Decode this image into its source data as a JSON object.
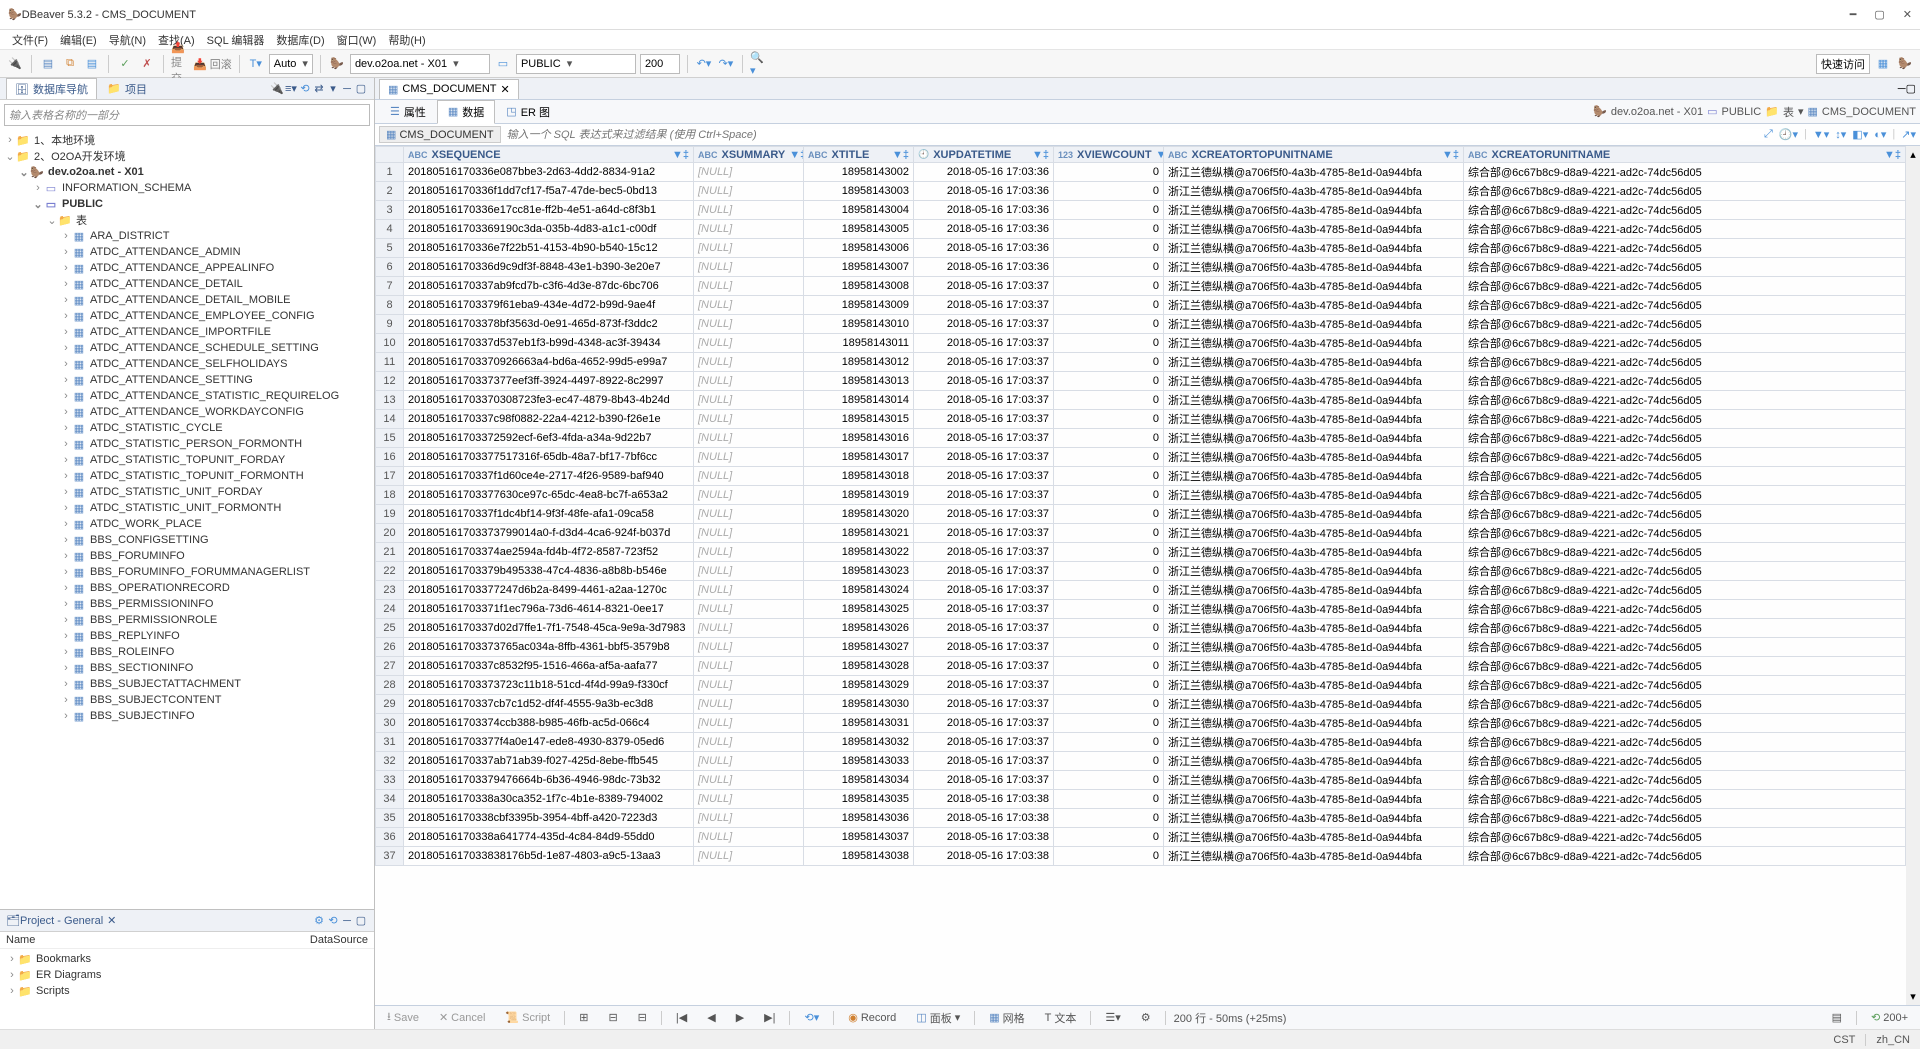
{
  "window_title": "DBeaver 5.3.2 - CMS_DOCUMENT",
  "menus": [
    "文件(F)",
    "编辑(E)",
    "导航(N)",
    "查找(A)",
    "SQL 编辑器",
    "数据库(D)",
    "窗口(W)",
    "帮助(H)"
  ],
  "toolbar": {
    "auto": "Auto",
    "connection": "dev.o2oa.net - X01",
    "schema": "PUBLIC",
    "limit": "200",
    "quick_access": "快速访问"
  },
  "nav": {
    "tab1": "数据库导航",
    "tab2": "项目",
    "filter_placeholder": "输入表格名称的一部分",
    "root1": "1、本地环境",
    "root2": "2、O2OA开发环境",
    "conn": "dev.o2oa.net - X01",
    "schema_info": "INFORMATION_SCHEMA",
    "schema_public": "PUBLIC",
    "tables_label": "表",
    "tables": [
      "ARA_DISTRICT",
      "ATDC_ATTENDANCE_ADMIN",
      "ATDC_ATTENDANCE_APPEALINFO",
      "ATDC_ATTENDANCE_DETAIL",
      "ATDC_ATTENDANCE_DETAIL_MOBILE",
      "ATDC_ATTENDANCE_EMPLOYEE_CONFIG",
      "ATDC_ATTENDANCE_IMPORTFILE",
      "ATDC_ATTENDANCE_SCHEDULE_SETTING",
      "ATDC_ATTENDANCE_SELFHOLIDAYS",
      "ATDC_ATTENDANCE_SETTING",
      "ATDC_ATTENDANCE_STATISTIC_REQUIRELOG",
      "ATDC_ATTENDANCE_WORKDAYCONFIG",
      "ATDC_STATISTIC_CYCLE",
      "ATDC_STATISTIC_PERSON_FORMONTH",
      "ATDC_STATISTIC_TOPUNIT_FORDAY",
      "ATDC_STATISTIC_TOPUNIT_FORMONTH",
      "ATDC_STATISTIC_UNIT_FORDAY",
      "ATDC_STATISTIC_UNIT_FORMONTH",
      "ATDC_WORK_PLACE",
      "BBS_CONFIGSETTING",
      "BBS_FORUMINFO",
      "BBS_FORUMINFO_FORUMMANAGERLIST",
      "BBS_OPERATIONRECORD",
      "BBS_PERMISSIONINFO",
      "BBS_PERMISSIONROLE",
      "BBS_REPLYINFO",
      "BBS_ROLEINFO",
      "BBS_SECTIONINFO",
      "BBS_SUBJECTATTACHMENT",
      "BBS_SUBJECTCONTENT",
      "BBS_SUBJECTINFO"
    ]
  },
  "project": {
    "title": "Project - General",
    "col_name": "Name",
    "col_ds": "DataSource",
    "items": [
      "Bookmarks",
      "ER Diagrams",
      "Scripts"
    ]
  },
  "editor": {
    "tab": "CMS_DOCUMENT",
    "subtabs": {
      "props": "属性",
      "data": "数据",
      "er": "ER 图"
    },
    "breadcrumb": [
      "dev.o2oa.net - X01",
      "PUBLIC",
      "表",
      "CMS_DOCUMENT"
    ],
    "filter_label": "CMS_DOCUMENT",
    "filter_placeholder": "输入一个 SQL 表达式来过滤结果 (使用 Ctrl+Space)"
  },
  "columns": [
    "XSEQUENCE",
    "XSUMMARY",
    "XTITLE",
    "XUPDATETIME",
    "XVIEWCOUNT",
    "XCREATORTOPUNITNAME",
    "XCREATORUNITNAME"
  ],
  "null": "[NULL]",
  "rows": [
    {
      "seq": "20180516170336e087bbe3-2d63-4dd2-8834-91a2",
      "title": "18958143002",
      "upd": "2018-05-16 17:03:36",
      "vc": "0",
      "top": "浙江兰德纵横@a706f5f0-4a3b-4785-8e1d-0a944bfa",
      "unit": "综合部@6c67b8c9-d8a9-4221-ad2c-74dc56d05"
    },
    {
      "seq": "20180516170336f1dd7cf17-f5a7-47de-bec5-0bd13",
      "title": "18958143003",
      "upd": "2018-05-16 17:03:36",
      "vc": "0",
      "top": "浙江兰德纵横@a706f5f0-4a3b-4785-8e1d-0a944bfa",
      "unit": "综合部@6c67b8c9-d8a9-4221-ad2c-74dc56d05"
    },
    {
      "seq": "20180516170336e17cc81e-ff2b-4e51-a64d-c8f3b1",
      "title": "18958143004",
      "upd": "2018-05-16 17:03:36",
      "vc": "0",
      "top": "浙江兰德纵横@a706f5f0-4a3b-4785-8e1d-0a944bfa",
      "unit": "综合部@6c67b8c9-d8a9-4221-ad2c-74dc56d05"
    },
    {
      "seq": "201805161703369190c3da-035b-4d83-a1c1-c00df",
      "title": "18958143005",
      "upd": "2018-05-16 17:03:36",
      "vc": "0",
      "top": "浙江兰德纵横@a706f5f0-4a3b-4785-8e1d-0a944bfa",
      "unit": "综合部@6c67b8c9-d8a9-4221-ad2c-74dc56d05"
    },
    {
      "seq": "20180516170336e7f22b51-4153-4b90-b540-15c12",
      "title": "18958143006",
      "upd": "2018-05-16 17:03:36",
      "vc": "0",
      "top": "浙江兰德纵横@a706f5f0-4a3b-4785-8e1d-0a944bfa",
      "unit": "综合部@6c67b8c9-d8a9-4221-ad2c-74dc56d05"
    },
    {
      "seq": "20180516170336d9c9df3f-8848-43e1-b390-3e20e7",
      "title": "18958143007",
      "upd": "2018-05-16 17:03:36",
      "vc": "0",
      "top": "浙江兰德纵横@a706f5f0-4a3b-4785-8e1d-0a944bfa",
      "unit": "综合部@6c67b8c9-d8a9-4221-ad2c-74dc56d05"
    },
    {
      "seq": "20180516170337ab9fcd7b-c3f6-4d3e-87dc-6bc706",
      "title": "18958143008",
      "upd": "2018-05-16 17:03:37",
      "vc": "0",
      "top": "浙江兰德纵横@a706f5f0-4a3b-4785-8e1d-0a944bfa",
      "unit": "综合部@6c67b8c9-d8a9-4221-ad2c-74dc56d05"
    },
    {
      "seq": "201805161703379f61eba9-434e-4d72-b99d-9ae4f",
      "title": "18958143009",
      "upd": "2018-05-16 17:03:37",
      "vc": "0",
      "top": "浙江兰德纵横@a706f5f0-4a3b-4785-8e1d-0a944bfa",
      "unit": "综合部@6c67b8c9-d8a9-4221-ad2c-74dc56d05"
    },
    {
      "seq": "201805161703378bf3563d-0e91-465d-873f-f3ddc2",
      "title": "18958143010",
      "upd": "2018-05-16 17:03:37",
      "vc": "0",
      "top": "浙江兰德纵横@a706f5f0-4a3b-4785-8e1d-0a944bfa",
      "unit": "综合部@6c67b8c9-d8a9-4221-ad2c-74dc56d05"
    },
    {
      "seq": "20180516170337d537eb1f3-b99d-4348-ac3f-39434",
      "title": "18958143011",
      "upd": "2018-05-16 17:03:37",
      "vc": "0",
      "top": "浙江兰德纵横@a706f5f0-4a3b-4785-8e1d-0a944bfa",
      "unit": "综合部@6c67b8c9-d8a9-4221-ad2c-74dc56d05"
    },
    {
      "seq": "201805161703370926663a4-bd6a-4652-99d5-e99a7",
      "title": "18958143012",
      "upd": "2018-05-16 17:03:37",
      "vc": "0",
      "top": "浙江兰德纵横@a706f5f0-4a3b-4785-8e1d-0a944bfa",
      "unit": "综合部@6c67b8c9-d8a9-4221-ad2c-74dc56d05"
    },
    {
      "seq": "20180516170337377eef3ff-3924-4497-8922-8c2997",
      "title": "18958143013",
      "upd": "2018-05-16 17:03:37",
      "vc": "0",
      "top": "浙江兰德纵横@a706f5f0-4a3b-4785-8e1d-0a944bfa",
      "unit": "综合部@6c67b8c9-d8a9-4221-ad2c-74dc56d05"
    },
    {
      "seq": "201805161703370308723fe3-ec47-4879-8b43-4b24d",
      "title": "18958143014",
      "upd": "2018-05-16 17:03:37",
      "vc": "0",
      "top": "浙江兰德纵横@a706f5f0-4a3b-4785-8e1d-0a944bfa",
      "unit": "综合部@6c67b8c9-d8a9-4221-ad2c-74dc56d05"
    },
    {
      "seq": "20180516170337c98f0882-22a4-4212-b390-f26e1e",
      "title": "18958143015",
      "upd": "2018-05-16 17:03:37",
      "vc": "0",
      "top": "浙江兰德纵横@a706f5f0-4a3b-4785-8e1d-0a944bfa",
      "unit": "综合部@6c67b8c9-d8a9-4221-ad2c-74dc56d05"
    },
    {
      "seq": "201805161703372592ecf-6ef3-4fda-a34a-9d22b7",
      "title": "18958143016",
      "upd": "2018-05-16 17:03:37",
      "vc": "0",
      "top": "浙江兰德纵横@a706f5f0-4a3b-4785-8e1d-0a944bfa",
      "unit": "综合部@6c67b8c9-d8a9-4221-ad2c-74dc56d05"
    },
    {
      "seq": "201805161703377517316f-65db-48a7-bf17-7bf6cc",
      "title": "18958143017",
      "upd": "2018-05-16 17:03:37",
      "vc": "0",
      "top": "浙江兰德纵横@a706f5f0-4a3b-4785-8e1d-0a944bfa",
      "unit": "综合部@6c67b8c9-d8a9-4221-ad2c-74dc56d05"
    },
    {
      "seq": "20180516170337f1d60ce4e-2717-4f26-9589-baf940",
      "title": "18958143018",
      "upd": "2018-05-16 17:03:37",
      "vc": "0",
      "top": "浙江兰德纵横@a706f5f0-4a3b-4785-8e1d-0a944bfa",
      "unit": "综合部@6c67b8c9-d8a9-4221-ad2c-74dc56d05"
    },
    {
      "seq": "201805161703377630ce97c-65dc-4ea8-bc7f-a653a2",
      "title": "18958143019",
      "upd": "2018-05-16 17:03:37",
      "vc": "0",
      "top": "浙江兰德纵横@a706f5f0-4a3b-4785-8e1d-0a944bfa",
      "unit": "综合部@6c67b8c9-d8a9-4221-ad2c-74dc56d05"
    },
    {
      "seq": "20180516170337f1dc4bf14-9f3f-48fe-afa1-09ca58",
      "title": "18958143020",
      "upd": "2018-05-16 17:03:37",
      "vc": "0",
      "top": "浙江兰德纵横@a706f5f0-4a3b-4785-8e1d-0a944bfa",
      "unit": "综合部@6c67b8c9-d8a9-4221-ad2c-74dc56d05"
    },
    {
      "seq": "201805161703373799014a0-f-d3d4-4ca6-924f-b037d",
      "title": "18958143021",
      "upd": "2018-05-16 17:03:37",
      "vc": "0",
      "top": "浙江兰德纵横@a706f5f0-4a3b-4785-8e1d-0a944bfa",
      "unit": "综合部@6c67b8c9-d8a9-4221-ad2c-74dc56d05"
    },
    {
      "seq": "201805161703374ae2594a-fd4b-4f72-8587-723f52",
      "title": "18958143022",
      "upd": "2018-05-16 17:03:37",
      "vc": "0",
      "top": "浙江兰德纵横@a706f5f0-4a3b-4785-8e1d-0a944bfa",
      "unit": "综合部@6c67b8c9-d8a9-4221-ad2c-74dc56d05"
    },
    {
      "seq": "201805161703379b495338-47c4-4836-a8b8b-b546e",
      "title": "18958143023",
      "upd": "2018-05-16 17:03:37",
      "vc": "0",
      "top": "浙江兰德纵横@a706f5f0-4a3b-4785-8e1d-0a944bfa",
      "unit": "综合部@6c67b8c9-d8a9-4221-ad2c-74dc56d05"
    },
    {
      "seq": "201805161703377247d6b2a-8499-4461-a2aa-1270c",
      "title": "18958143024",
      "upd": "2018-05-16 17:03:37",
      "vc": "0",
      "top": "浙江兰德纵横@a706f5f0-4a3b-4785-8e1d-0a944bfa",
      "unit": "综合部@6c67b8c9-d8a9-4221-ad2c-74dc56d05"
    },
    {
      "seq": "201805161703371f1ec796a-73d6-4614-8321-0ee17",
      "title": "18958143025",
      "upd": "2018-05-16 17:03:37",
      "vc": "0",
      "top": "浙江兰德纵横@a706f5f0-4a3b-4785-8e1d-0a944bfa",
      "unit": "综合部@6c67b8c9-d8a9-4221-ad2c-74dc56d05"
    },
    {
      "seq": "20180516170337d02d7ffe1-7f1-7548-45ca-9e9a-3d7983",
      "title": "18958143026",
      "upd": "2018-05-16 17:03:37",
      "vc": "0",
      "top": "浙江兰德纵横@a706f5f0-4a3b-4785-8e1d-0a944bfa",
      "unit": "综合部@6c67b8c9-d8a9-4221-ad2c-74dc56d05"
    },
    {
      "seq": "201805161703373765ac034a-8ffb-4361-bbf5-3579b8",
      "title": "18958143027",
      "upd": "2018-05-16 17:03:37",
      "vc": "0",
      "top": "浙江兰德纵横@a706f5f0-4a3b-4785-8e1d-0a944bfa",
      "unit": "综合部@6c67b8c9-d8a9-4221-ad2c-74dc56d05"
    },
    {
      "seq": "20180516170337c8532f95-1516-466a-af5a-aafa77",
      "title": "18958143028",
      "upd": "2018-05-16 17:03:37",
      "vc": "0",
      "top": "浙江兰德纵横@a706f5f0-4a3b-4785-8e1d-0a944bfa",
      "unit": "综合部@6c67b8c9-d8a9-4221-ad2c-74dc56d05"
    },
    {
      "seq": "201805161703373723c11b18-51cd-4f4d-99a9-f330cf",
      "title": "18958143029",
      "upd": "2018-05-16 17:03:37",
      "vc": "0",
      "top": "浙江兰德纵横@a706f5f0-4a3b-4785-8e1d-0a944bfa",
      "unit": "综合部@6c67b8c9-d8a9-4221-ad2c-74dc56d05"
    },
    {
      "seq": "20180516170337cb7c1d52-df4f-4555-9a3b-ec3d8",
      "title": "18958143030",
      "upd": "2018-05-16 17:03:37",
      "vc": "0",
      "top": "浙江兰德纵横@a706f5f0-4a3b-4785-8e1d-0a944bfa",
      "unit": "综合部@6c67b8c9-d8a9-4221-ad2c-74dc56d05"
    },
    {
      "seq": "201805161703374ccb388-b985-46fb-ac5d-066c4",
      "title": "18958143031",
      "upd": "2018-05-16 17:03:37",
      "vc": "0",
      "top": "浙江兰德纵横@a706f5f0-4a3b-4785-8e1d-0a944bfa",
      "unit": "综合部@6c67b8c9-d8a9-4221-ad2c-74dc56d05"
    },
    {
      "seq": "201805161703377f4a0e147-ede8-4930-8379-05ed6",
      "title": "18958143032",
      "upd": "2018-05-16 17:03:37",
      "vc": "0",
      "top": "浙江兰德纵横@a706f5f0-4a3b-4785-8e1d-0a944bfa",
      "unit": "综合部@6c67b8c9-d8a9-4221-ad2c-74dc56d05"
    },
    {
      "seq": "20180516170337ab71ab39-f027-425d-8ebe-ffb545",
      "title": "18958143033",
      "upd": "2018-05-16 17:03:37",
      "vc": "0",
      "top": "浙江兰德纵横@a706f5f0-4a3b-4785-8e1d-0a944bfa",
      "unit": "综合部@6c67b8c9-d8a9-4221-ad2c-74dc56d05"
    },
    {
      "seq": "201805161703379476664b-6b36-4946-98dc-73b32",
      "title": "18958143034",
      "upd": "2018-05-16 17:03:37",
      "vc": "0",
      "top": "浙江兰德纵横@a706f5f0-4a3b-4785-8e1d-0a944bfa",
      "unit": "综合部@6c67b8c9-d8a9-4221-ad2c-74dc56d05"
    },
    {
      "seq": "20180516170338a30ca352-1f7c-4b1e-8389-794002",
      "title": "18958143035",
      "upd": "2018-05-16 17:03:38",
      "vc": "0",
      "top": "浙江兰德纵横@a706f5f0-4a3b-4785-8e1d-0a944bfa",
      "unit": "综合部@6c67b8c9-d8a9-4221-ad2c-74dc56d05"
    },
    {
      "seq": "20180516170338cbf3395b-3954-4bff-a420-7223d3",
      "title": "18958143036",
      "upd": "2018-05-16 17:03:38",
      "vc": "0",
      "top": "浙江兰德纵横@a706f5f0-4a3b-4785-8e1d-0a944bfa",
      "unit": "综合部@6c67b8c9-d8a9-4221-ad2c-74dc56d05"
    },
    {
      "seq": "20180516170338a641774-435d-4c84-84d9-55dd0",
      "title": "18958143037",
      "upd": "2018-05-16 17:03:38",
      "vc": "0",
      "top": "浙江兰德纵横@a706f5f0-4a3b-4785-8e1d-0a944bfa",
      "unit": "综合部@6c67b8c9-d8a9-4221-ad2c-74dc56d05"
    },
    {
      "seq": "2018051617033838176b5d-1e87-4803-a9c5-13aa3",
      "title": "18958143038",
      "upd": "2018-05-16 17:03:38",
      "vc": "0",
      "top": "浙江兰德纵横@a706f5f0-4a3b-4785-8e1d-0a944bfa",
      "unit": "综合部@6c67b8c9-d8a9-4221-ad2c-74dc56d05"
    }
  ],
  "status": {
    "save": "Save",
    "cancel": "Cancel",
    "script": "Script",
    "record": "Record",
    "panels": "面板",
    "grid": "网格",
    "text": "文本",
    "rows": "200 行 - 50ms (+25ms)",
    "more": "200+"
  },
  "bottom": {
    "tz": "CST",
    "locale": "zh_CN"
  }
}
